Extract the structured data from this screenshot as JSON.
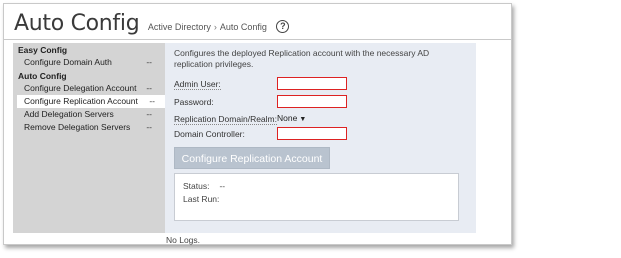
{
  "header": {
    "title": "Auto Config",
    "breadcrumb_parent": "Active Directory",
    "breadcrumb_separator": "›",
    "breadcrumb_current": "Auto Config",
    "help_icon": "help-icon"
  },
  "sidebar": {
    "sections": [
      {
        "heading": "Easy Config",
        "items": [
          {
            "label": "Configure Domain Auth",
            "status": "--"
          }
        ]
      },
      {
        "heading": "Auto Config",
        "items": [
          {
            "label": "Configure Delegation Account",
            "status": "--"
          },
          {
            "label": "Configure Replication Account",
            "status": "--"
          },
          {
            "label": "Add Delegation Servers",
            "status": "--"
          },
          {
            "label": "Remove Delegation Servers",
            "status": "--"
          }
        ]
      }
    ]
  },
  "main": {
    "description": "Configures the deployed Replication account with the necessary AD replication privileges.",
    "form": {
      "admin_user_label": "Admin User:",
      "admin_user_value": "",
      "password_label": "Password:",
      "password_value": "",
      "realm_label": "Replication Domain/Realm:",
      "realm_selected": "None",
      "domain_controller_label": "Domain Controller:",
      "domain_controller_value": ""
    },
    "submit_label": "Configure Replication Account",
    "status": {
      "status_label": "Status:",
      "status_value": "--",
      "last_run_label": "Last Run:"
    }
  },
  "logs": "No Logs.",
  "colors": {
    "panel_bg": "#e8ecf3",
    "sidebar_bg": "#d4d4d4",
    "button_bg": "#b9c3cf",
    "required_border": "#dd2222"
  }
}
